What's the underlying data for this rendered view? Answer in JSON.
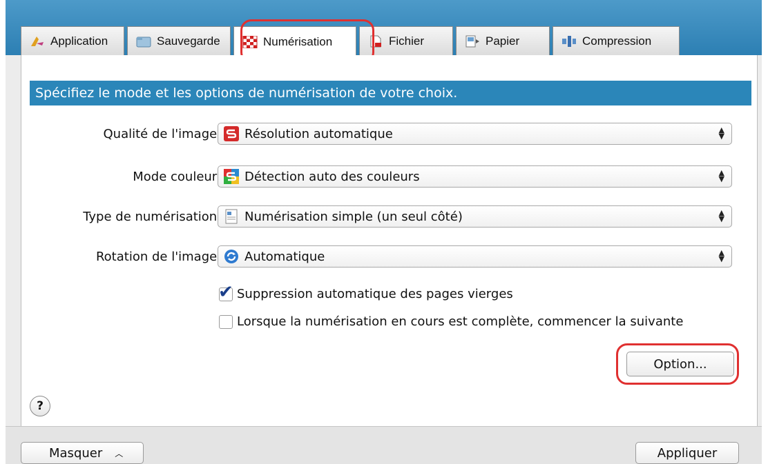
{
  "tabs": [
    {
      "label": "Application",
      "icon": "application-icon"
    },
    {
      "label": "Sauvegarde",
      "icon": "folder-icon"
    },
    {
      "label": "Numérisation",
      "icon": "scan-icon"
    },
    {
      "label": "Fichier",
      "icon": "file-icon"
    },
    {
      "label": "Papier",
      "icon": "paper-icon"
    },
    {
      "label": "Compression",
      "icon": "compression-icon"
    }
  ],
  "active_tab": "Numérisation",
  "banner": "Spécifiez le mode et les options de numérisation de votre choix.",
  "fields": {
    "quality": {
      "label": "Qualité de l'image :",
      "value": "Résolution automatique"
    },
    "color": {
      "label": "Mode couleur :",
      "value": "Détection auto des couleurs"
    },
    "scan_type": {
      "label": "Type de numérisation :",
      "value": "Numérisation simple (un seul côté)"
    },
    "rotation": {
      "label": "Rotation de l'image :",
      "value": "Automatique"
    }
  },
  "checkboxes": {
    "blank_pages": {
      "label": "Suppression automatique des pages vierges",
      "checked": true
    },
    "continue_scan": {
      "label": "Lorsque la numérisation en cours est complète, commencer la suivante",
      "checked": false
    }
  },
  "buttons": {
    "option": "Option...",
    "help": "?",
    "hide": "Masquer",
    "apply": "Appliquer"
  },
  "colors": {
    "accent": "#2b86b9",
    "highlight": "#e03030"
  }
}
